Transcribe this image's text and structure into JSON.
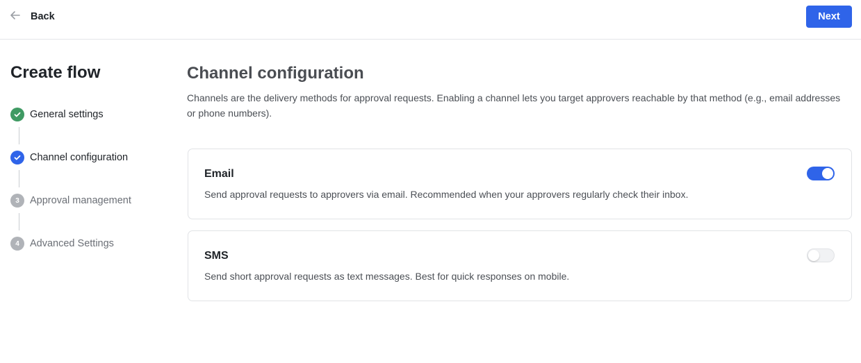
{
  "topbar": {
    "back_label": "Back",
    "next_label": "Next"
  },
  "sidebar": {
    "title": "Create flow",
    "steps": [
      {
        "label": "General settings",
        "status": "done"
      },
      {
        "label": "Channel configuration",
        "status": "current"
      },
      {
        "label": "Approval management",
        "status": "todo",
        "number": "3"
      },
      {
        "label": "Advanced Settings",
        "status": "todo",
        "number": "4"
      }
    ]
  },
  "main": {
    "title": "Channel configuration",
    "description": "Channels are the delivery methods for approval requests. Enabling a channel lets you target approvers reachable by that method (e.g., email addresses or phone numbers).",
    "channels": [
      {
        "title": "Email",
        "description": "Send approval requests to approvers via email. Recommended when your approvers regularly check their inbox.",
        "enabled": true
      },
      {
        "title": "SMS",
        "description": "Send short approval requests as text messages. Best for quick responses on mobile.",
        "enabled": false
      }
    ]
  },
  "colors": {
    "accent": "#2f64e9",
    "success": "#3f9a63",
    "inactive": "#b0b3b8"
  }
}
